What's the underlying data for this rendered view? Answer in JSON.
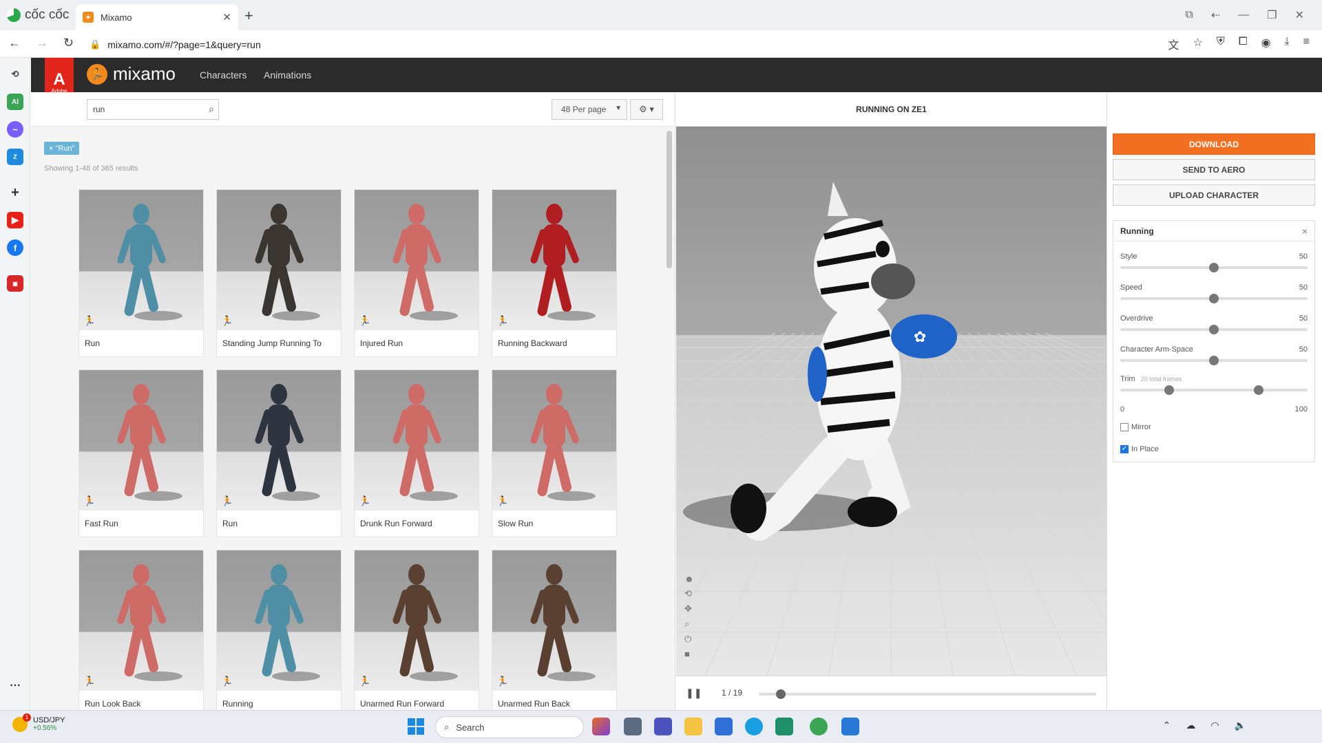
{
  "browser": {
    "brand": "cốc cốc",
    "tab_title": "Mixamo",
    "url": "mixamo.com/#/?page=1&query=run"
  },
  "mixamo": {
    "adobe_label": "Adobe",
    "logo_text": "mixamo",
    "nav": [
      "Characters",
      "Animations"
    ]
  },
  "search": {
    "value": "run",
    "per_page": "48 Per page",
    "filter_tag": "× \"Run\"",
    "results_text": "Showing 1-48 of 365 results"
  },
  "results": [
    {
      "label": "Run",
      "color": "#4f8fa6"
    },
    {
      "label": "Standing Jump Running To",
      "color": "#3a3530"
    },
    {
      "label": "Injured Run",
      "color": "#cf6b66"
    },
    {
      "label": "Running Backward",
      "color": "#b01e22"
    },
    {
      "label": "Fast Run",
      "color": "#cf6b66"
    },
    {
      "label": "Run",
      "color": "#2f3540"
    },
    {
      "label": "Drunk Run Forward",
      "color": "#cf6b66"
    },
    {
      "label": "Slow Run",
      "color": "#cf6b66"
    },
    {
      "label": "Run Look Back",
      "color": "#cf6b66"
    },
    {
      "label": "Running",
      "color": "#4f8fa6"
    },
    {
      "label": "Unarmed Run Forward",
      "color": "#5a4030"
    },
    {
      "label": "Unarmed Run Back",
      "color": "#5a4030"
    }
  ],
  "viewer": {
    "title": "RUNNING ON ZE1",
    "frame_text": "1 / 19",
    "frame_position": 0.05
  },
  "panel": {
    "download": "DOWNLOAD",
    "send_aero": "SEND TO AERO",
    "upload": "UPLOAD CHARACTER",
    "anim_name": "Running",
    "close": "×",
    "sliders": [
      {
        "name": "Style",
        "value": "50",
        "level": 0.5
      },
      {
        "name": "Speed",
        "value": "50",
        "level": 0.5
      },
      {
        "name": "Overdrive",
        "value": "50",
        "level": 0.5
      },
      {
        "name": "Character Arm-Space",
        "value": "50",
        "level": 0.5
      }
    ],
    "trim": {
      "name": "Trim",
      "note": "20 total frames",
      "min": "0",
      "max": "100",
      "start": 0.26,
      "end": 0.74
    },
    "mirror": {
      "label": "Mirror",
      "checked": false
    },
    "in_place": {
      "label": "In Place",
      "checked": true
    }
  },
  "taskbar": {
    "ticker_symbol": "USD/JPY",
    "ticker_change": "+0.56%",
    "badge": "1",
    "search_label": "Search"
  }
}
